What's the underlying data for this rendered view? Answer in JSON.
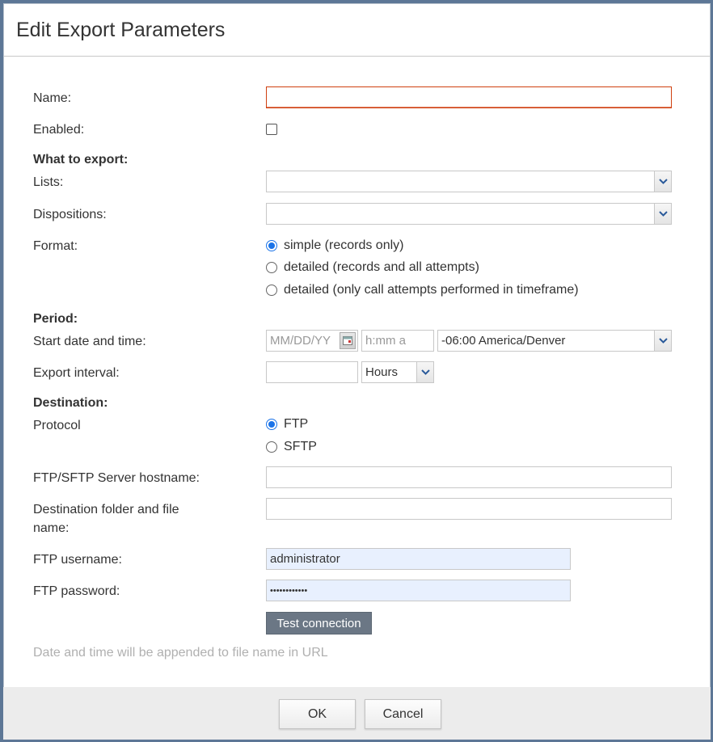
{
  "dialog": {
    "title": "Edit Export Parameters"
  },
  "form": {
    "name_label": "Name:",
    "name_value": "",
    "enabled_label": "Enabled:",
    "enabled_checked": false,
    "what_to_export": "What to export:",
    "lists_label": "Lists:",
    "lists_value": "",
    "dispositions_label": "Dispositions:",
    "dispositions_value": "",
    "format_label": "Format:",
    "format_options": [
      {
        "label": "simple (records only)",
        "checked": true
      },
      {
        "label": "detailed (records and all attempts)",
        "checked": false
      },
      {
        "label": "detailed (only call attempts performed in timeframe)",
        "checked": false
      }
    ],
    "period": "Period:",
    "start_label": "Start date and time:",
    "date_placeholder": "MM/DD/YY",
    "time_placeholder": "h:mm a",
    "timezone_value": "-06:00 America/Denver",
    "interval_label": "Export interval:",
    "interval_value": "",
    "interval_unit": "Hours",
    "destination": "Destination:",
    "protocol_label": "Protocol",
    "protocol_options": [
      {
        "label": "FTP",
        "checked": true
      },
      {
        "label": "SFTP",
        "checked": false
      }
    ],
    "hostname_label": "FTP/SFTP Server hostname:",
    "hostname_value": "",
    "folder_label_1": "Destination folder and file",
    "folder_label_2": "name:",
    "folder_value": "",
    "username_label": "FTP username:",
    "username_value": "administrator",
    "password_label": "FTP password:",
    "password_value": "••••••••••••",
    "test_button": "Test connection",
    "hint": "Date and time will be appended to file name in URL"
  },
  "footer": {
    "ok": "OK",
    "cancel": "Cancel"
  }
}
